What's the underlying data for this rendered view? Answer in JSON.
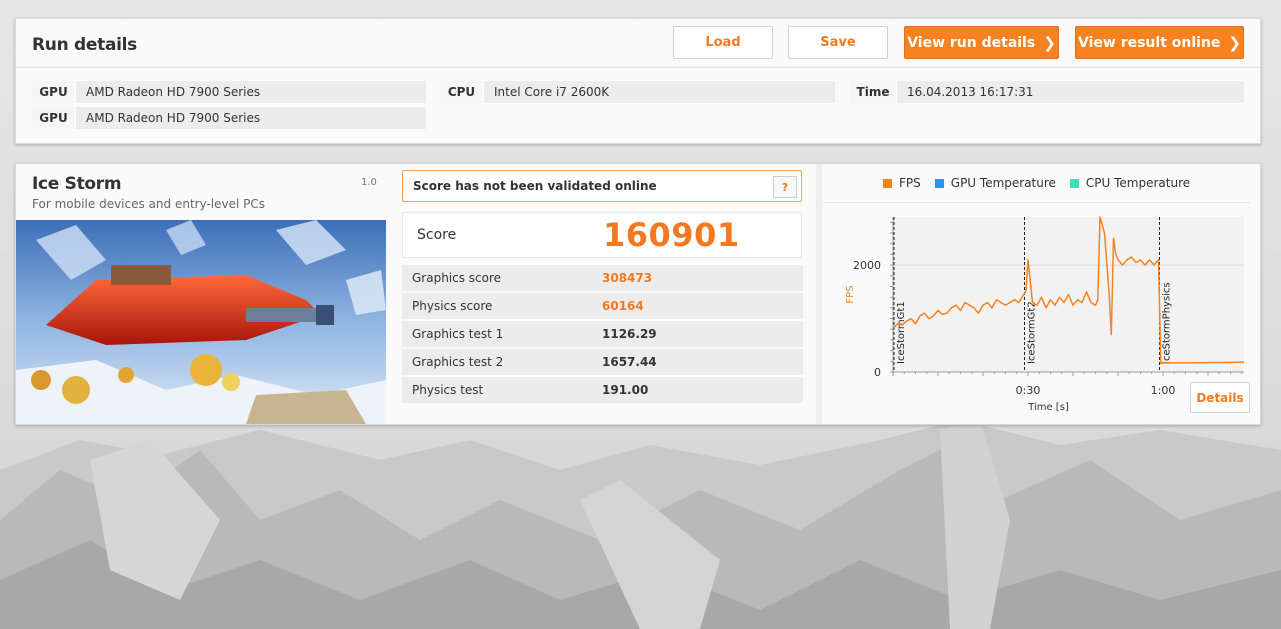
{
  "run_details": {
    "title": "Run details",
    "load_label": "Load",
    "save_label": "Save",
    "view_run_label": "View run details",
    "view_online_label": "View result online",
    "gpu_rows": [
      {
        "label": "GPU",
        "value": "AMD Radeon HD 7900 Series"
      },
      {
        "label": "GPU",
        "value": "AMD Radeon HD 7900 Series"
      }
    ],
    "cpu": {
      "label": "CPU",
      "value": "Intel Core i7 2600K"
    },
    "time": {
      "label": "Time",
      "value": "16.04.2013 16:17:31"
    }
  },
  "benchmark": {
    "name": "Ice Storm",
    "description": "For mobile devices and entry-level PCs",
    "version": "1.0",
    "validation": "Score has not been validated online",
    "help_label": "?",
    "score_label": "Score",
    "score_value": "160901",
    "rows": [
      {
        "label": "Graphics score",
        "value": "308473",
        "highlight": true
      },
      {
        "label": "Physics score",
        "value": "60164",
        "highlight": true
      },
      {
        "label": "Graphics test 1",
        "value": "1126.29",
        "highlight": false
      },
      {
        "label": "Graphics test 2",
        "value": "1657.44",
        "highlight": false
      },
      {
        "label": "Physics test",
        "value": "191.00",
        "highlight": false
      }
    ],
    "details_label": "Details"
  },
  "colors": {
    "accent": "#f7821f",
    "fps": "#f7821f",
    "gpu_temp": "#1e9be9",
    "cpu_temp": "#2ee8b8"
  },
  "chart_data": {
    "type": "line",
    "legend": [
      "FPS",
      "GPU Temperature",
      "CPU Temperature"
    ],
    "legend_placement": "top",
    "ylabel": "FPS",
    "xlabel": "Time [s]",
    "ylim": [
      0,
      2900
    ],
    "xlim": [
      0,
      78
    ],
    "yticks": [
      0,
      2000
    ],
    "xticks": [
      {
        "value": 30,
        "label": "0:30"
      },
      {
        "value": 60,
        "label": "1:00"
      }
    ],
    "markers": [
      {
        "x": 0,
        "label": "IceStormGt1"
      },
      {
        "x": 29,
        "label": "IceStormGt2"
      },
      {
        "x": 59,
        "label": "IceStormPhysics"
      }
    ],
    "series": [
      {
        "name": "FPS",
        "x": [
          0,
          1,
          2,
          3,
          4,
          5,
          6,
          7,
          8,
          9,
          10,
          11,
          12,
          13,
          14,
          15,
          16,
          17,
          18,
          19,
          20,
          21,
          22,
          23,
          24,
          25,
          26,
          27,
          28,
          29,
          29.5,
          30,
          31,
          32,
          33,
          34,
          35,
          36,
          37,
          38,
          39,
          40,
          41,
          42,
          43,
          44,
          45,
          45.5,
          46,
          47,
          48,
          48.5,
          49,
          49.5,
          50,
          51,
          52,
          53,
          54,
          55,
          56,
          57,
          58,
          59,
          59.5,
          60,
          65,
          70,
          75,
          78
        ],
        "values": [
          820,
          900,
          880,
          950,
          1000,
          900,
          1050,
          1100,
          1000,
          1050,
          1150,
          1080,
          1100,
          1200,
          1250,
          1150,
          1300,
          1250,
          1200,
          1100,
          1250,
          1300,
          1200,
          1350,
          1300,
          1250,
          1300,
          1350,
          1300,
          1450,
          1500,
          2100,
          1300,
          1250,
          1400,
          1200,
          1350,
          1250,
          1400,
          1300,
          1450,
          1250,
          1350,
          1300,
          1500,
          1300,
          1250,
          1350,
          2900,
          2600,
          1500,
          700,
          2500,
          2200,
          2100,
          2000,
          2100,
          2150,
          2050,
          2100,
          2000,
          2100,
          2000,
          2100,
          160,
          170,
          170,
          175,
          180,
          185
        ]
      }
    ]
  }
}
